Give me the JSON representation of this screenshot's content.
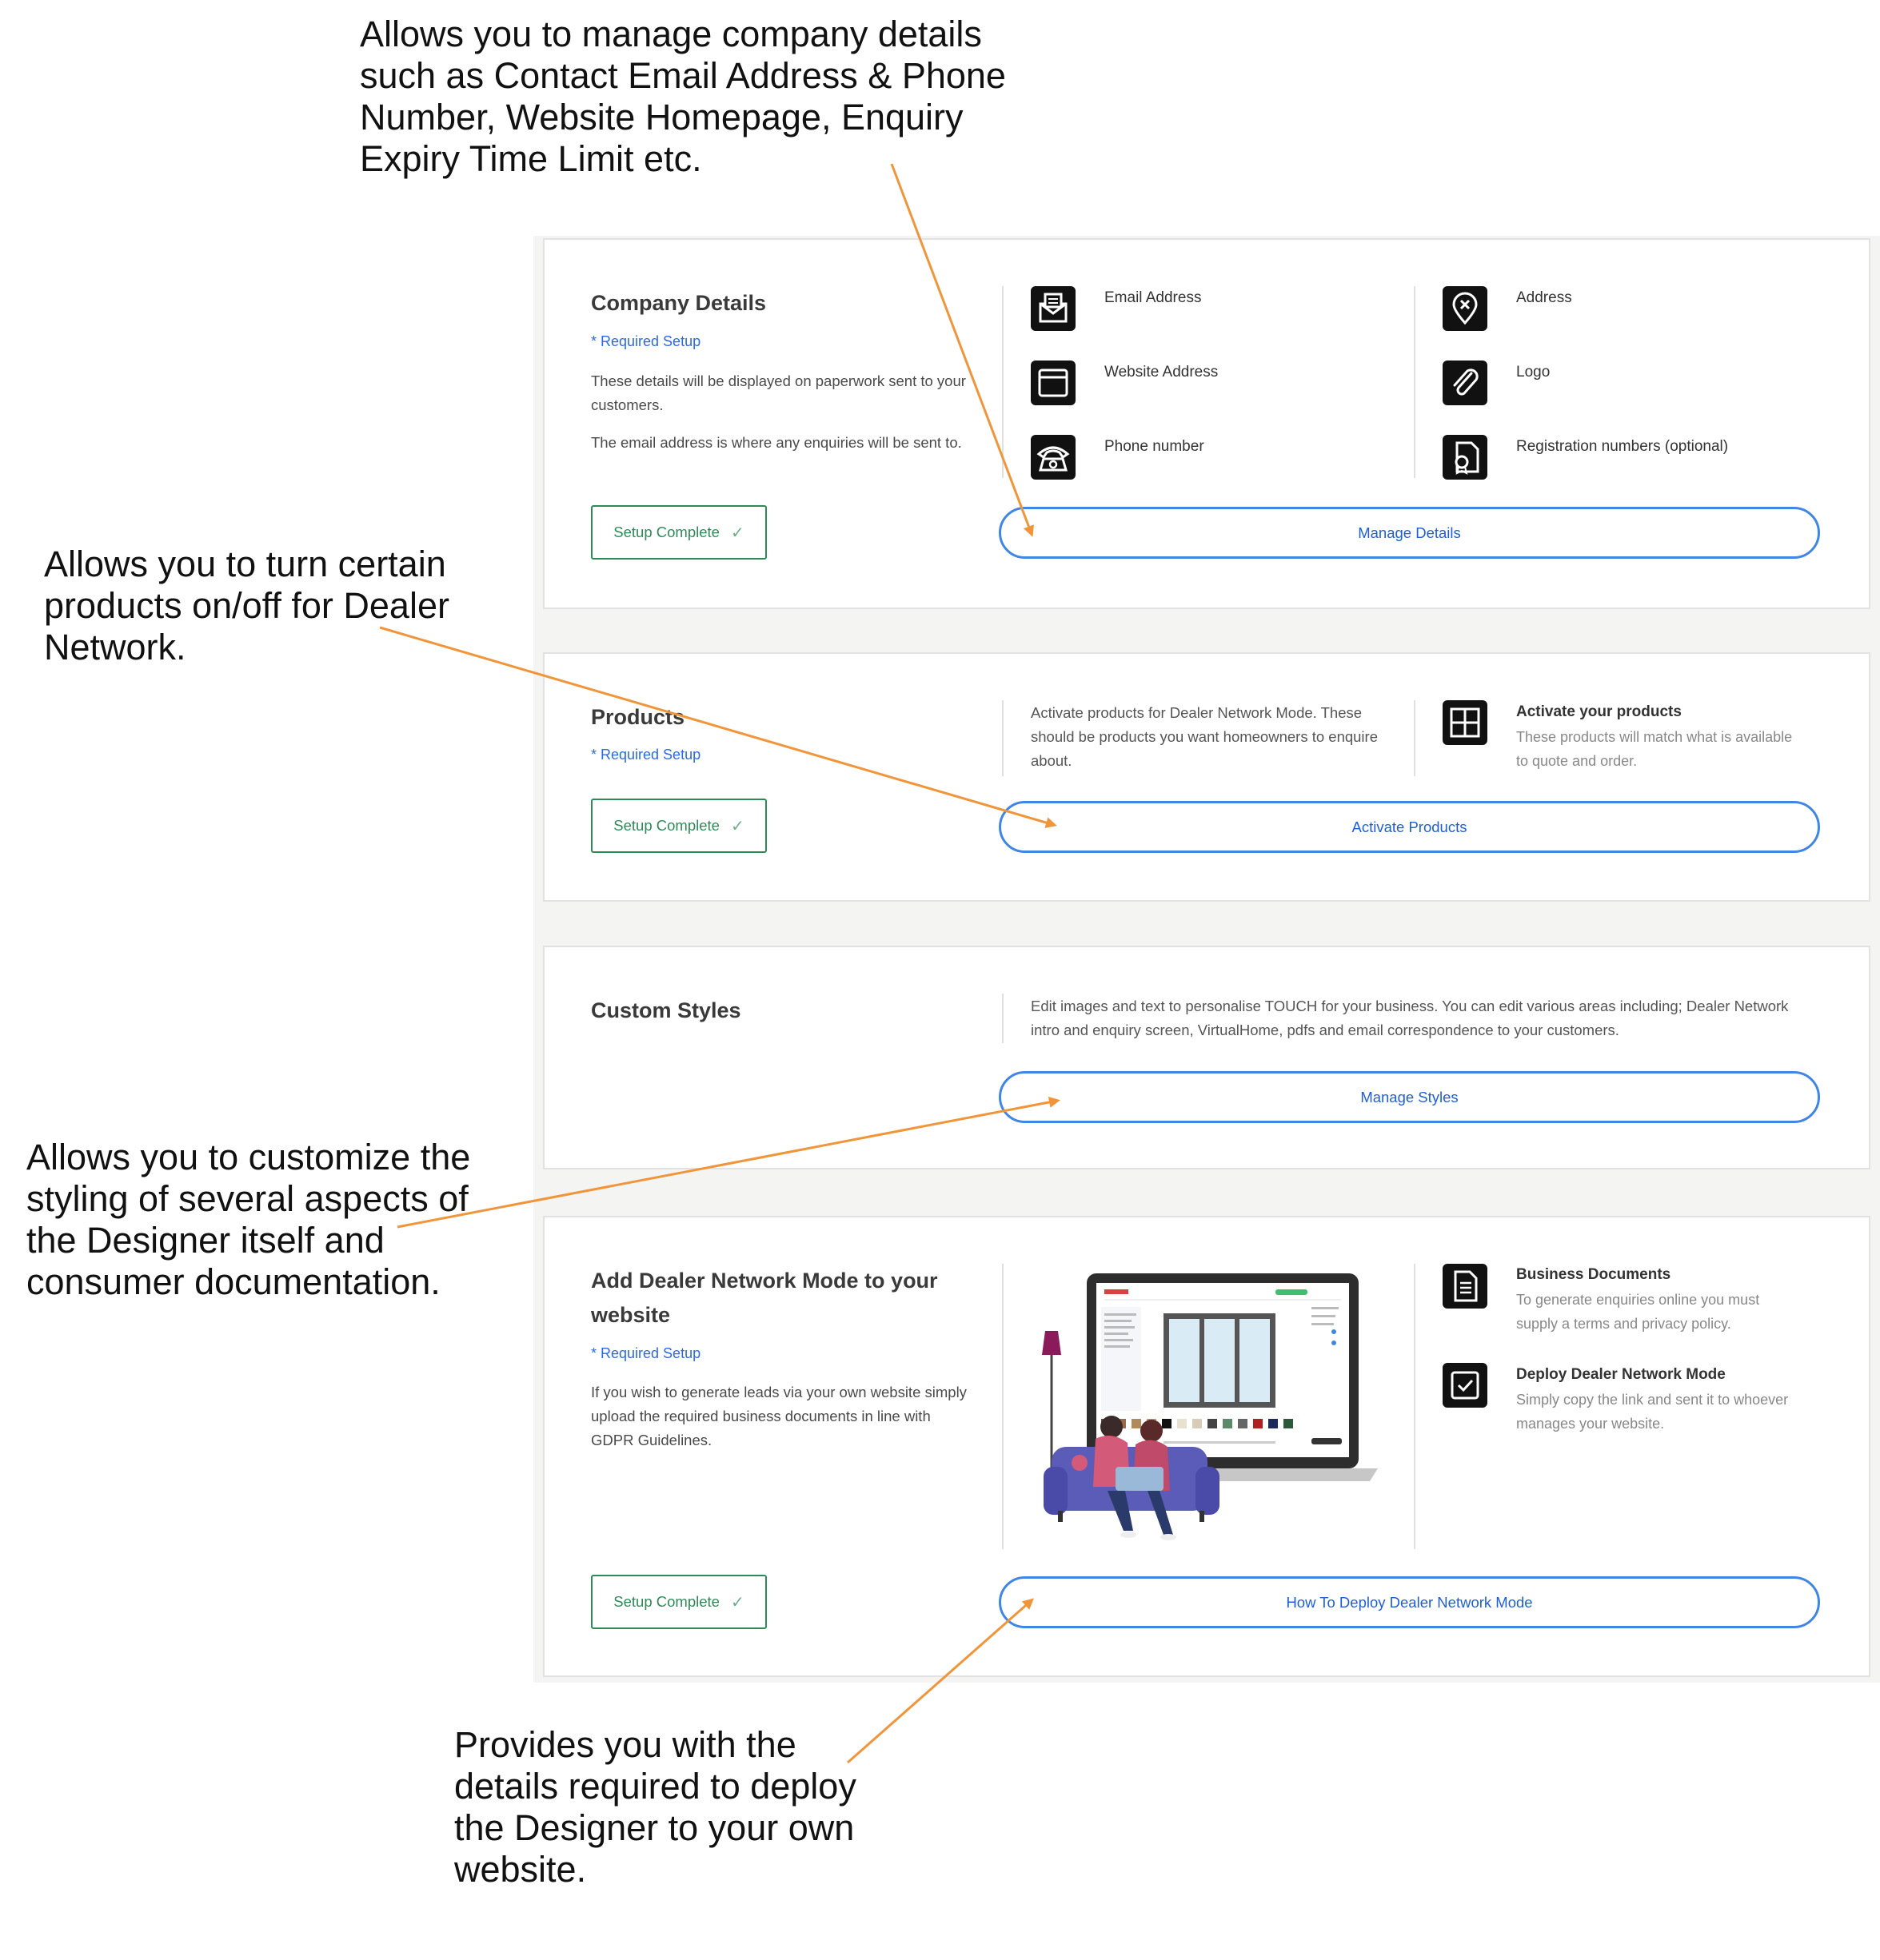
{
  "callouts": {
    "company": "Allows you to manage company details such as Contact Email Address & Phone Number, Website Homepage, Enquiry Expiry Time Limit etc.",
    "products": "Allows you to turn certain products on/off for Dealer Network.",
    "styles": "Allows you to customize the styling of several aspects of the Designer itself and consumer documentation.",
    "deploy": "Provides you with the details required to deploy the Designer to your own website."
  },
  "company": {
    "title": "Company Details",
    "required": "* Required Setup",
    "desc1": "These details will be displayed on paperwork sent to your customers.",
    "desc2": "The email address is where any enquiries will be sent to.",
    "setup": "Setup Complete",
    "fields": {
      "email": "Email Address",
      "website": "Website Address",
      "phone": "Phone number",
      "address": "Address",
      "logo": "Logo",
      "registration": "Registration numbers (optional)"
    },
    "button": "Manage Details"
  },
  "products": {
    "title": "Products",
    "required": "* Required Setup",
    "setup": "Setup Complete",
    "desc": "Activate products for Dealer Network Mode. These should be products you want homeowners to enquire about.",
    "feature_title": "Activate your products",
    "feature_sub": "These products will match what is available to quote and order.",
    "button": "Activate Products"
  },
  "styles": {
    "title": "Custom Styles",
    "desc": "Edit images and text to personalise TOUCH for your business. You can edit various areas including; Dealer Network intro and enquiry screen, VirtualHome, pdfs and email correspondence to your customers.",
    "button": "Manage Styles"
  },
  "dealer": {
    "title": "Add Dealer Network Mode to your website",
    "required": "* Required Setup",
    "desc": "If you wish to generate leads via your own website simply upload the required business documents in line with GDPR Guidelines.",
    "setup": "Setup Complete",
    "docs_title": "Business Documents",
    "docs_sub": "To generate enquiries online you must supply a terms and privacy policy.",
    "deploy_title": "Deploy Dealer Network Mode",
    "deploy_sub": "Simply copy the link and sent it to whoever manages your website.",
    "button": "How To Deploy Dealer Network Mode"
  },
  "colors": {
    "accent_blue": "#3f86e6",
    "success_green": "#2e8b57",
    "arrow_orange": "#f0953a",
    "panel_bg": "#f4f4f2"
  },
  "icons": [
    "email-icon",
    "website-icon",
    "phone-icon",
    "address-icon",
    "logo-icon",
    "registration-icon",
    "grid-icon",
    "document-icon",
    "checkbox-icon",
    "check-icon"
  ]
}
